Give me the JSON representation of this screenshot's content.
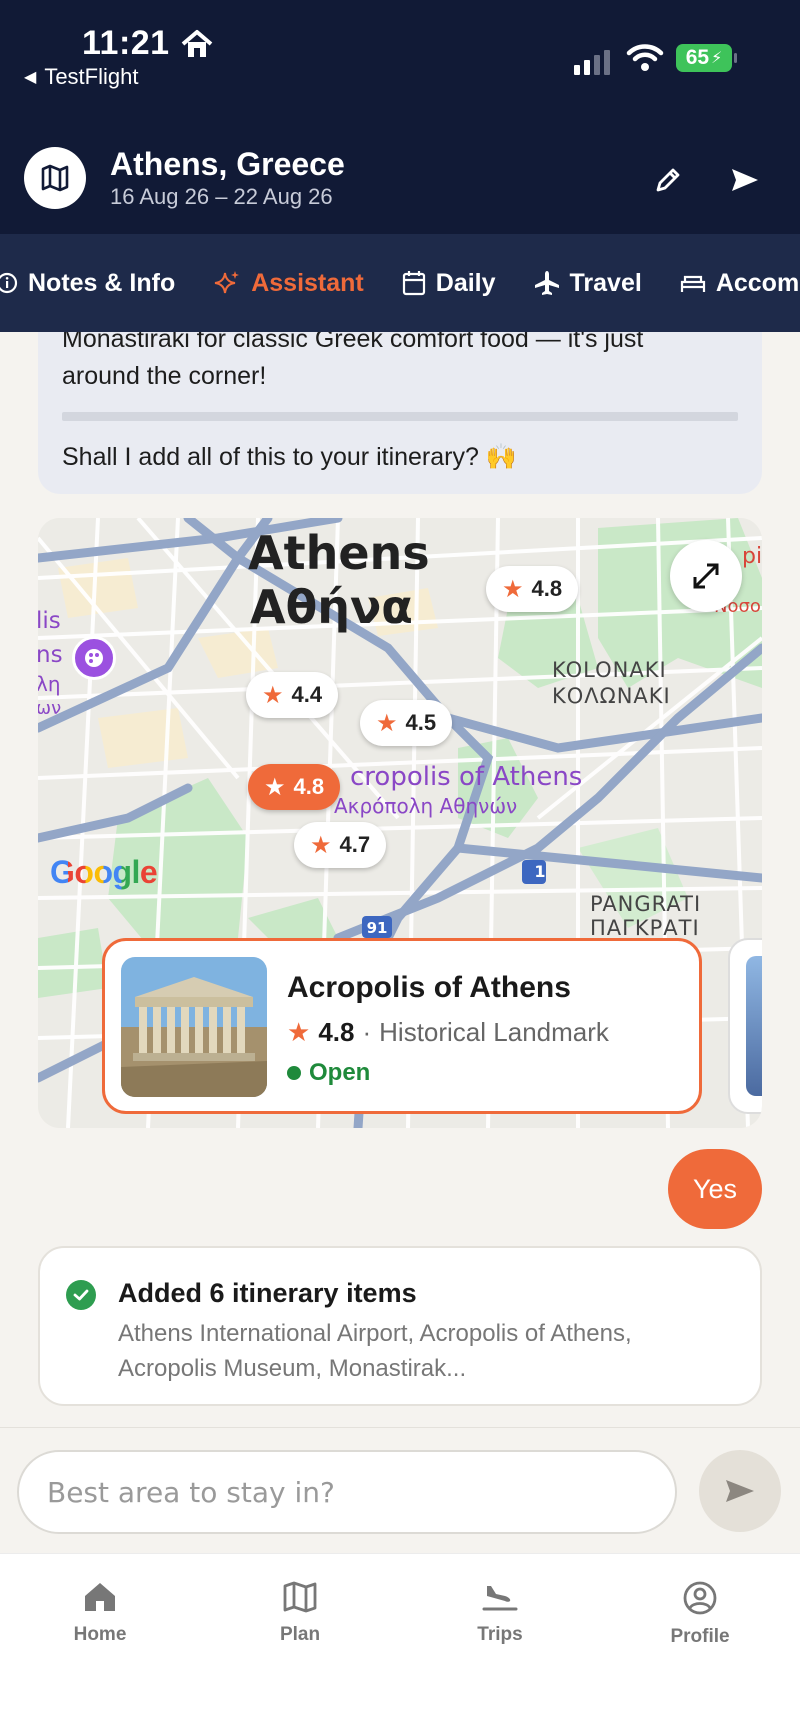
{
  "status_bar": {
    "time": "11:21",
    "back_app": "TestFlight",
    "battery": "65"
  },
  "header": {
    "title": "Athens, Greece",
    "dates": "16 Aug 26 – 22 Aug 26",
    "icons": [
      "map-icon",
      "pencil-icon",
      "send-icon"
    ]
  },
  "tabs": [
    {
      "label": "Notes & Info",
      "icon": "info-icon",
      "active": false
    },
    {
      "label": "Assistant",
      "icon": "sparkle-icon",
      "active": true
    },
    {
      "label": "Daily",
      "icon": "calendar-icon",
      "active": false
    },
    {
      "label": "Travel",
      "icon": "plane-icon",
      "active": false
    },
    {
      "label": "Accomm",
      "icon": "bed-icon",
      "active": false
    }
  ],
  "assistant_message": {
    "line1": "Monastiraki for classic Greek comfort food — it's just",
    "line2": "around the corner!",
    "question": "Shall I add all of this to your itinerary? 🙌"
  },
  "map": {
    "city_en": "Athens",
    "city_gr": "Αθήνα",
    "kolonaki_en": "KOLONAKI",
    "kolonaki_gr": "ΚΟΛΩΝΑΚΙ",
    "pangrati_en": "PANGRATI",
    "pangrati_gr": "ΠΑΓΚΡΑΤΙ",
    "acropolis_en": "cropolis of Athens",
    "acropolis_gr": "Ακρόπολη Αθηνών",
    "edge_left": [
      "lis",
      "ns",
      "λη",
      "ων"
    ],
    "edge_right_top": "pi",
    "edge_right_gr": "Νοσο",
    "road_1": "1",
    "road_91": "91",
    "google": "Google",
    "ratings": [
      "4.8",
      "4.4",
      "4.5",
      "4.8",
      "4.7"
    ]
  },
  "place_card": {
    "name": "Acropolis of Athens",
    "rating": "4.8",
    "separator": "·",
    "category": "Historical Landmark",
    "status": "Open"
  },
  "user_message": "Yes",
  "added": {
    "title": "Added 6 itinerary items",
    "desc": "Athens International Airport, Acropolis of Athens, Acropolis Museum, Monastirak..."
  },
  "input": {
    "value": "Best area to stay in?"
  },
  "bottom_nav": [
    {
      "label": "Home",
      "icon": "home-icon"
    },
    {
      "label": "Plan",
      "icon": "map-icon"
    },
    {
      "label": "Trips",
      "icon": "plane-landing-icon"
    },
    {
      "label": "Profile",
      "icon": "profile-icon"
    }
  ],
  "colors": {
    "navy": "#111a36",
    "tabbar": "#1e2a4a",
    "accent": "#ef6a3a",
    "open_green": "#1f8a3b"
  }
}
